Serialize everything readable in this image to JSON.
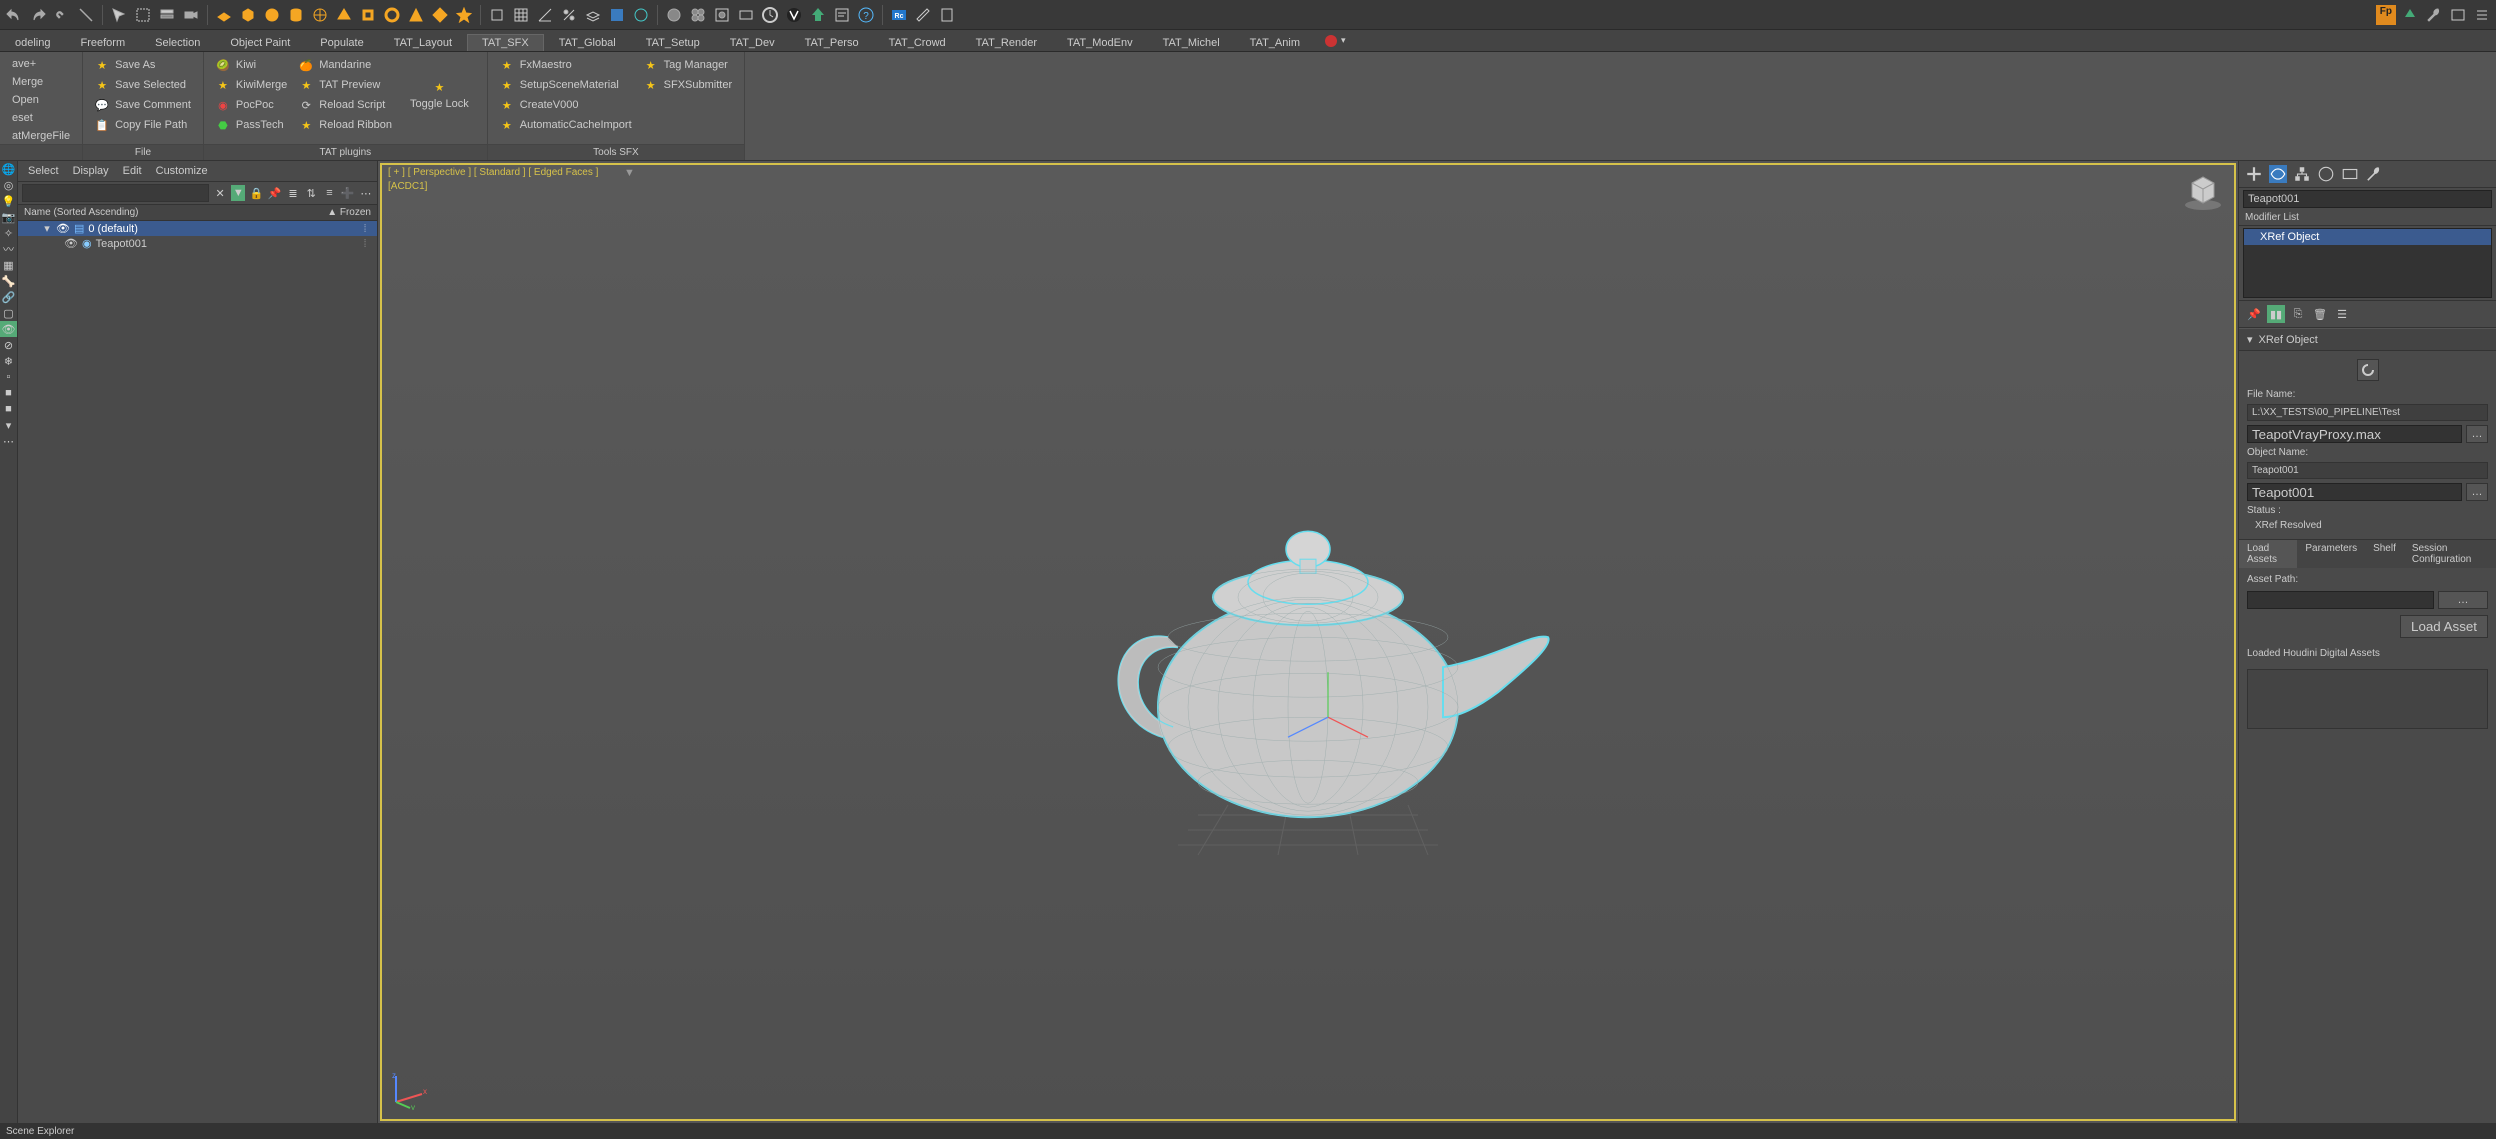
{
  "main_tabs": [
    "odeling",
    "Freeform",
    "Selection",
    "Object Paint",
    "Populate",
    "TAT_Layout",
    "TAT_SFX",
    "TAT_Global",
    "TAT_Setup",
    "TAT_Dev",
    "TAT_Perso",
    "TAT_Crowd",
    "TAT_Render",
    "TAT_ModEnv",
    "TAT_Michel",
    "TAT_Anim"
  ],
  "active_main_tab": "TAT_SFX",
  "ribbon": {
    "left": {
      "items": [
        "ave+",
        "Merge",
        "Open",
        "eset",
        "atMergeFile"
      ]
    },
    "file": {
      "label": "File",
      "items": [
        "Save As",
        "Save Selected",
        "Save Comment",
        "Copy File Path"
      ]
    },
    "plugins": {
      "label": "TAT plugins",
      "col1": [
        "Kiwi",
        "KiwiMerge",
        "PocPoc",
        "PassTech"
      ],
      "col2": [
        "Mandarine",
        "TAT Preview",
        "Reload Script",
        "Reload Ribbon"
      ],
      "toggle_lock": "Toggle Lock"
    },
    "sfx": {
      "label": "Tools SFX",
      "col1": [
        "FxMaestro",
        "SetupSceneMaterial",
        "CreateV000",
        "AutomaticCacheImport"
      ],
      "col2": [
        "Tag Manager",
        "SFXSubmitter"
      ]
    }
  },
  "scene": {
    "menu": [
      "Select",
      "Display",
      "Edit",
      "Customize"
    ],
    "col_left": "Name (Sorted Ascending)",
    "col_right": "▲ Frozen",
    "root": "0 (default)",
    "child": "Teapot001",
    "footer": "Scene Explorer"
  },
  "viewport": {
    "label": "[ + ] [ Perspective ] [ Standard ] [ Edged Faces ]",
    "sub": "[ACDC1]"
  },
  "right": {
    "object_name": "Teapot001",
    "modlist_label": "Modifier List",
    "mod_item": "XRef Object",
    "rollout": "XRef Object",
    "file_label": "File Name:",
    "file_path": "L:\\XX_TESTS\\00_PIPELINE\\Test",
    "file_value": "TeapotVrayProxy.max",
    "obj_label": "Object Name:",
    "obj_preset": "Teapot001",
    "obj_value": "Teapot001",
    "status_label": "Status :",
    "status_value": "XRef Resolved",
    "tabs": [
      "Load Assets",
      "Parameters",
      "Shelf",
      "Session Configuration"
    ],
    "active_tab": "Load Assets",
    "asset_path_label": "Asset Path:",
    "load_btn": "Load Asset",
    "hda_label": "Loaded Houdini Digital Assets"
  }
}
